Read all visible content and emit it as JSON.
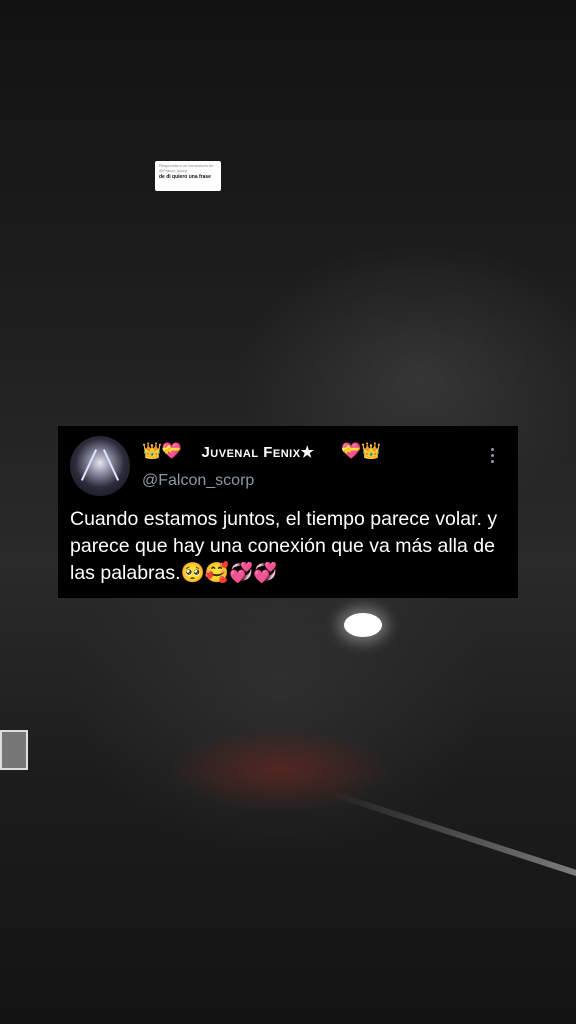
{
  "reply_card": {
    "subtitle": "Respuesta a un comentario de @Falcon_scorp",
    "text": "de di quiero una frase"
  },
  "tweet": {
    "badges_left": "👑💝ᓄ",
    "display_name": "Juvenal Fenix★",
    "badges_right": "⁹⁹⁹💝👑",
    "handle": "@Falcon_scorp",
    "text": "Cuando estamos juntos, el tiempo parece volar. y parece que hay una conexión que va más alla de las palabras.🥺🥰💞💞"
  },
  "icons": {
    "menu": "more-vertical-icon",
    "avatar": "profile-avatar"
  }
}
